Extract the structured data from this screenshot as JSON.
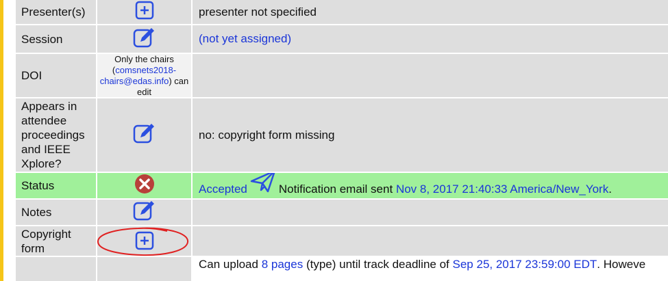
{
  "rows": [
    {
      "label": "Presenter(s)",
      "icon": "plus-box-icon",
      "value": "presenter not specified"
    },
    {
      "label": "Session",
      "icon": "edit-icon",
      "value_link": "(not yet assigned)"
    },
    {
      "label": "DOI",
      "note_pre": "Only the chairs (",
      "note_link": "comsnets2018-chairs@edas.info",
      "note_post": ") can edit",
      "value": ""
    },
    {
      "label": "Appears in attendee proceedings and IEEE Xplore?",
      "icon": "edit-icon",
      "value": "no: copyright form missing"
    },
    {
      "label": "Status",
      "icon": "cancel-circle-icon",
      "status_link": "Accepted",
      "notif_icon": "paper-plane-icon",
      "notif_text": "Notification email sent",
      "notif_date": "Nov 8, 2017 21:40:33 America/New_York",
      "notif_end": "."
    },
    {
      "label": "Notes",
      "icon": "edit-icon",
      "value": ""
    },
    {
      "label": "Copyright form",
      "icon": "plus-box-icon",
      "value": ""
    },
    {
      "label": "",
      "upload_pre": "Can upload",
      "upload_pages": "8 pages",
      "upload_mid": "(type) until track deadline of",
      "upload_date": "Sep 25, 2017 23:59:00 EDT",
      "upload_post": ". Howeve"
    }
  ],
  "colors": {
    "grey": "#dedede",
    "green": "#a0f09a",
    "link": "#1a35d8",
    "icon_blue": "#2b4fe0",
    "cancel_red": "#b8403a",
    "annotation_red": "#e02020"
  }
}
